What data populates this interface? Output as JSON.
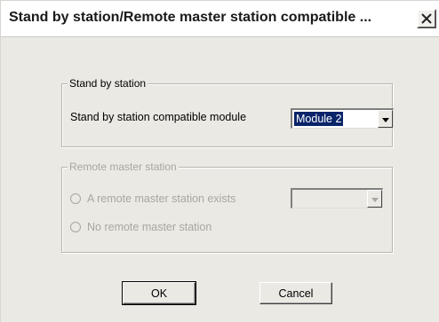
{
  "window": {
    "title": "Stand by station/Remote master station compatible ..."
  },
  "standby_group": {
    "legend": "Stand by station",
    "compatible_module_label": "Stand by station compatible module",
    "compatible_module_value": "Module 2"
  },
  "remote_group": {
    "legend": "Remote master station",
    "radio_exists_label": "A remote master station exists",
    "radio_none_label": "No remote master station",
    "remote_select_value": ""
  },
  "buttons": {
    "ok": "OK",
    "cancel": "Cancel"
  },
  "icons": {
    "close": "close-icon",
    "dropdown": "chevron-down-icon"
  },
  "colors": {
    "selection": "#0a246a",
    "disabled_text": "#a8a6a0"
  }
}
